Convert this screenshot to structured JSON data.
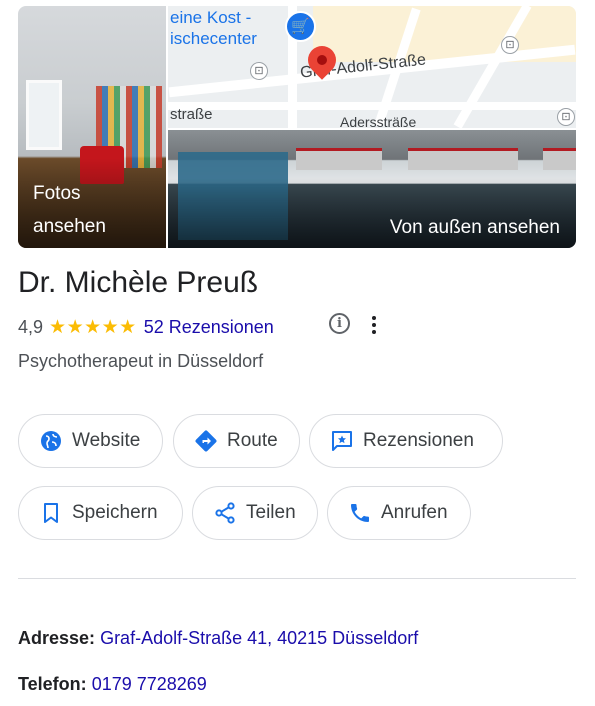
{
  "media": {
    "photos_label": "Fotos\nansehen",
    "street_view_label": "Von außen ansehen",
    "map_labels": {
      "shop_line1": "eine Kost -",
      "shop_line2": "ischecenter",
      "street_main": "Graf-Adolf-Straße",
      "street_left": "straße",
      "street_bottom": "Aderssträße"
    }
  },
  "business": {
    "name": "Dr. Michèle Preuß",
    "rating": "4,9",
    "stars": "★★★★★",
    "reviews_link": "52 Rezensionen",
    "category": "Psychotherapeut in Düsseldorf"
  },
  "actions": [
    {
      "label": "Website",
      "icon": "globe-icon"
    },
    {
      "label": "Route",
      "icon": "directions-icon"
    },
    {
      "label": "Rezensionen",
      "icon": "review-icon"
    },
    {
      "label": "Speichern",
      "icon": "bookmark-icon"
    },
    {
      "label": "Teilen",
      "icon": "share-icon"
    },
    {
      "label": "Anrufen",
      "icon": "phone-icon"
    }
  ],
  "details": {
    "address_label": "Adresse:",
    "address_value": "Graf-Adolf-Straße 41, 40215 Düsseldorf",
    "phone_label": "Telefon:",
    "phone_value": "0179 7728269"
  },
  "colors": {
    "accent_blue": "#1a73e8",
    "link": "#1a0dab",
    "star": "#fbbc04",
    "pin": "#ea4335"
  }
}
